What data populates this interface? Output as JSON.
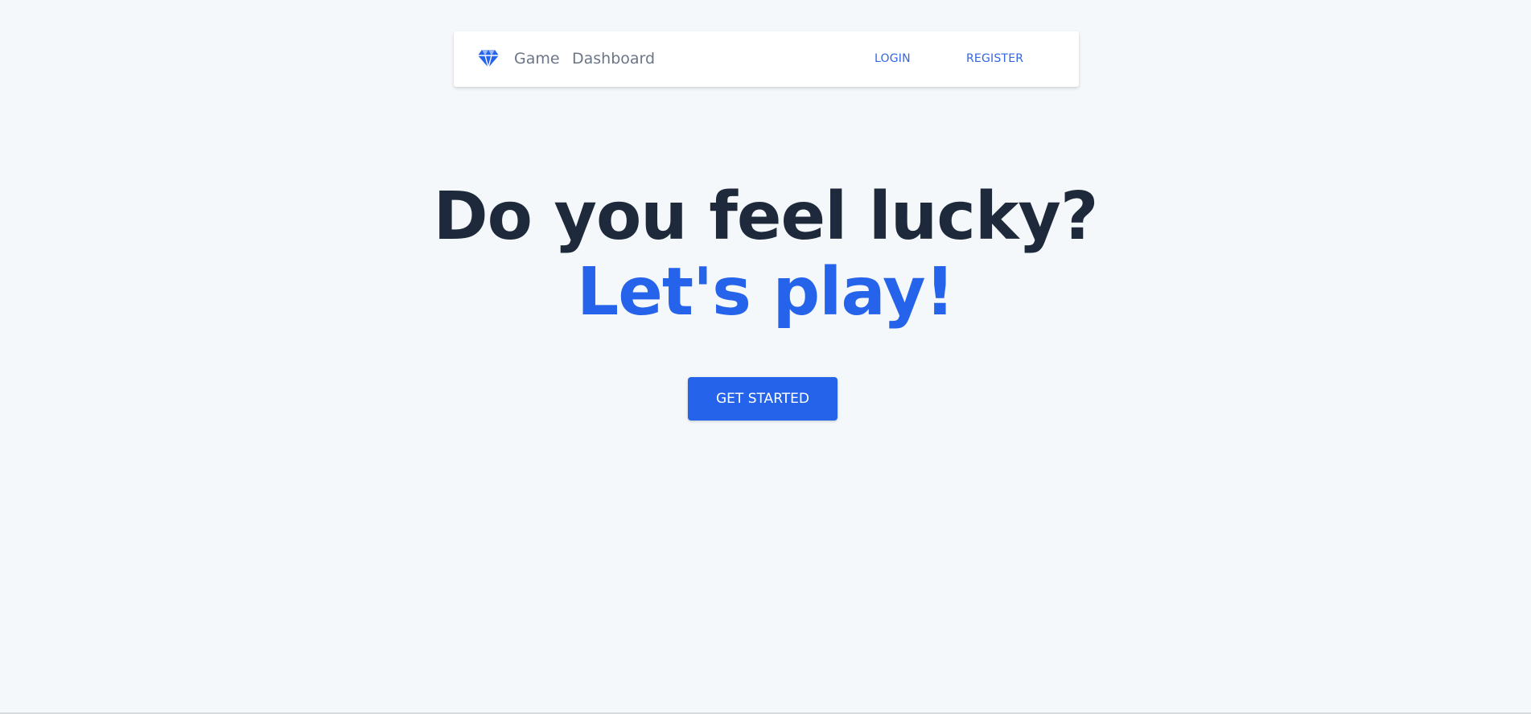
{
  "navbar": {
    "brand_icon": "diamond-icon",
    "links": [
      {
        "label": "Game"
      },
      {
        "label": "Dashboard"
      }
    ],
    "auth": {
      "login_label": "LOGIN",
      "register_label": "REGISTER"
    }
  },
  "hero": {
    "headline": "Do you feel lucky?",
    "subheadline": "Let's play!",
    "cta_label": "GET STARTED"
  },
  "colors": {
    "background": "#f5f8fb",
    "accent": "#2563eb",
    "heading": "#1e2a3b",
    "nav_text": "#6b7588"
  }
}
